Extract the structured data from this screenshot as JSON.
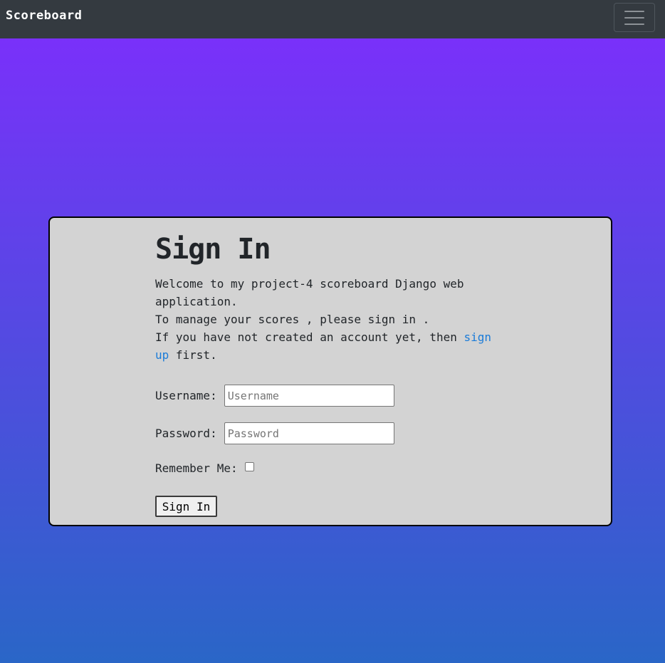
{
  "navbar": {
    "brand": "Scoreboard",
    "toggler_icon": "hamburger-icon"
  },
  "signin": {
    "title": "Sign In",
    "welcome_line": "Welcome to my project-4 scoreboard Django web application.",
    "manage_line": "To manage your scores , please sign in .",
    "signup_prefix": "If you have not created an account yet, then ",
    "signup_link": "sign up",
    "signup_suffix": " first.",
    "username_label": "Username:",
    "username_placeholder": "Username",
    "password_label": "Password:",
    "password_placeholder": "Password",
    "remember_label": "Remember Me:",
    "submit_label": "Sign In"
  },
  "colors": {
    "gradient_top": "#7a30fa",
    "gradient_bottom": "#2a66c7",
    "navbar": "#343a40",
    "card": "#d3d3d3",
    "link": "#1a7bd8"
  }
}
